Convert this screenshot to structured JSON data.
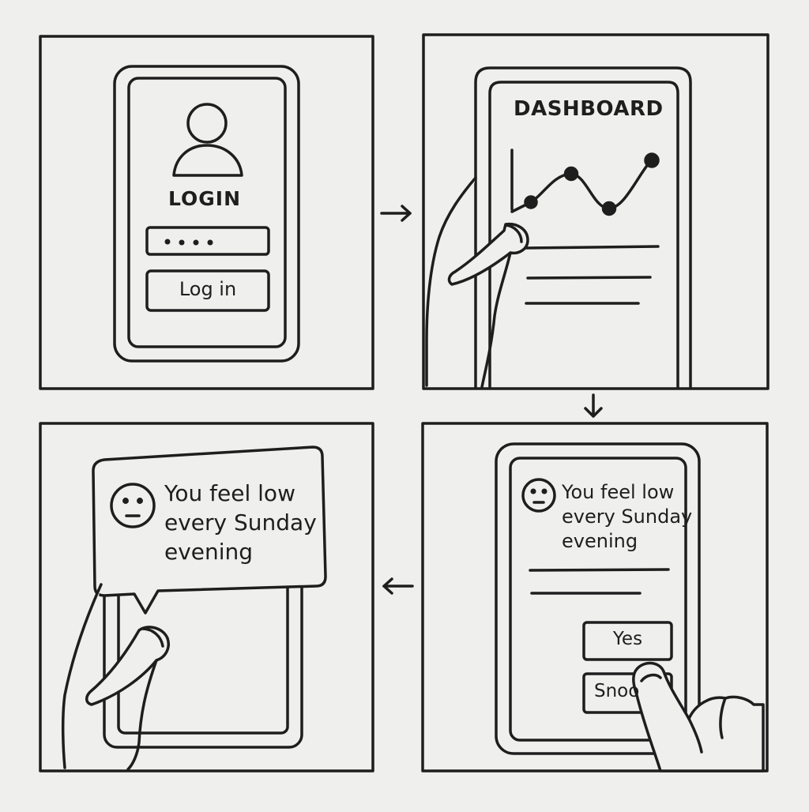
{
  "panel1": {
    "title": "LOGIN",
    "password_mask": "••••",
    "button_label": "Log in"
  },
  "panel2": {
    "title": "DASHBOARD"
  },
  "panel3": {
    "notification_text": "You feel low\nevery Sunday\nevening"
  },
  "panel4": {
    "message_text": "You feel low\nevery Sunday\nevening",
    "yes_label": "Yes",
    "snooze_label": "Snoo"
  },
  "colors": {
    "background": "#efefed",
    "ink": "#1e1e1e"
  }
}
